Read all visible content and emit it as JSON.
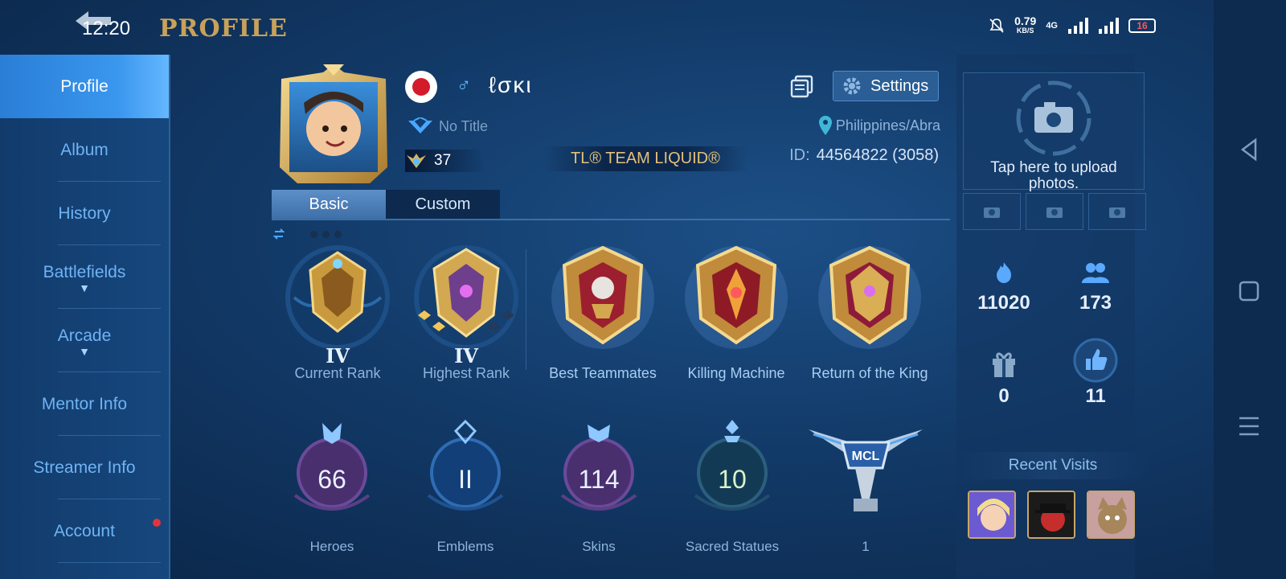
{
  "status_bar": {
    "time": "12:20",
    "speed_value": "0.79",
    "speed_unit": "KB/S",
    "network": "4G",
    "battery": "16"
  },
  "header": {
    "title": "PROFILE"
  },
  "sidebar": {
    "items": [
      {
        "label": "Profile",
        "active": true
      },
      {
        "label": "Album"
      },
      {
        "label": "History"
      },
      {
        "label": "Battlefields",
        "expandable": true
      },
      {
        "label": "Arcade",
        "expandable": true
      },
      {
        "label": "Mentor Info"
      },
      {
        "label": "Streamer Info"
      },
      {
        "label": "Account",
        "notification": true
      }
    ]
  },
  "profile": {
    "name": "ℓσκι",
    "title": "No Title",
    "level": "37",
    "squad": "TL® TEAM LIQUID®",
    "location": "Philippines/Abra",
    "id_label": "ID:",
    "id_value": "44564822 (3058)",
    "settings_label": "Settings",
    "flag_country": "japan",
    "gender": "male"
  },
  "tabs": {
    "basic": "Basic",
    "custom": "Custom",
    "active": "basic"
  },
  "ranks": [
    {
      "label": "Current Rank",
      "tier": "IV"
    },
    {
      "label": "Highest Rank",
      "tier": "IV"
    },
    {
      "label": "Best Teammates"
    },
    {
      "label": "Killing Machine"
    },
    {
      "label": "Return of the King"
    }
  ],
  "stats": [
    {
      "label": "Heroes",
      "value": "66"
    },
    {
      "label": "Emblems",
      "value": "II"
    },
    {
      "label": "Skins",
      "value": "114"
    },
    {
      "label": "Sacred Statues",
      "value": "10"
    },
    {
      "label": "1",
      "value": "",
      "badge": "MCL"
    }
  ],
  "right_panel": {
    "upload_text": "Tap here to upload photos.",
    "popularity": "11020",
    "followers": "173",
    "gifts": "0",
    "likes": "11",
    "recent_visits_title": "Recent Visits"
  },
  "colors": {
    "accent_gold": "#c8a25a",
    "active_blue": "#3a97ee",
    "background": "#123a68"
  }
}
